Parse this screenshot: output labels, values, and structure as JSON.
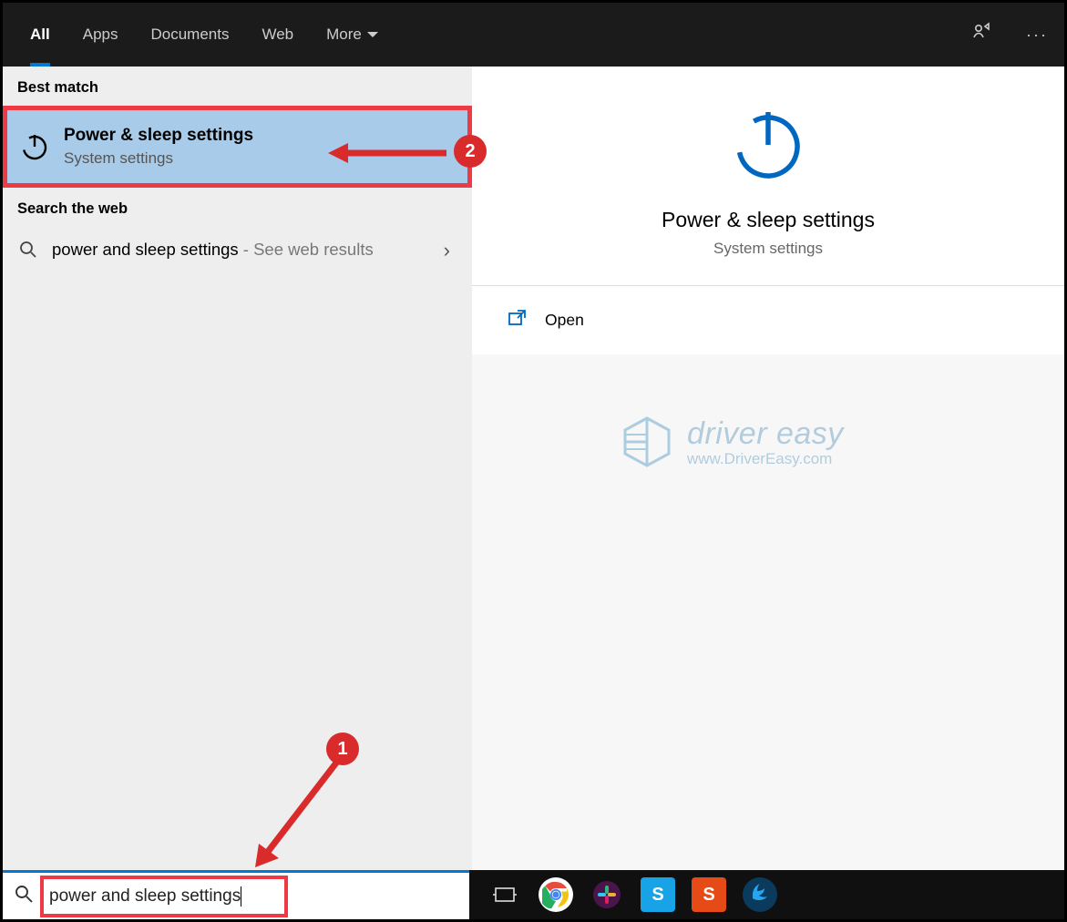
{
  "tabs": {
    "all": "All",
    "apps": "Apps",
    "documents": "Documents",
    "web": "Web",
    "more": "More"
  },
  "sections": {
    "best_match": "Best match",
    "search_web": "Search the web"
  },
  "best_match": {
    "title": "Power & sleep settings",
    "subtitle": "System settings"
  },
  "web_result": {
    "query": "power and sleep settings",
    "hint": " - See web results"
  },
  "preview": {
    "title": "Power & sleep settings",
    "subtitle": "System settings",
    "open_label": "Open"
  },
  "watermark": {
    "brand": "driver easy",
    "url": "www.DriverEasy.com"
  },
  "search": {
    "value": "power and sleep settings"
  },
  "annotations": {
    "badge1": "1",
    "badge2": "2"
  }
}
